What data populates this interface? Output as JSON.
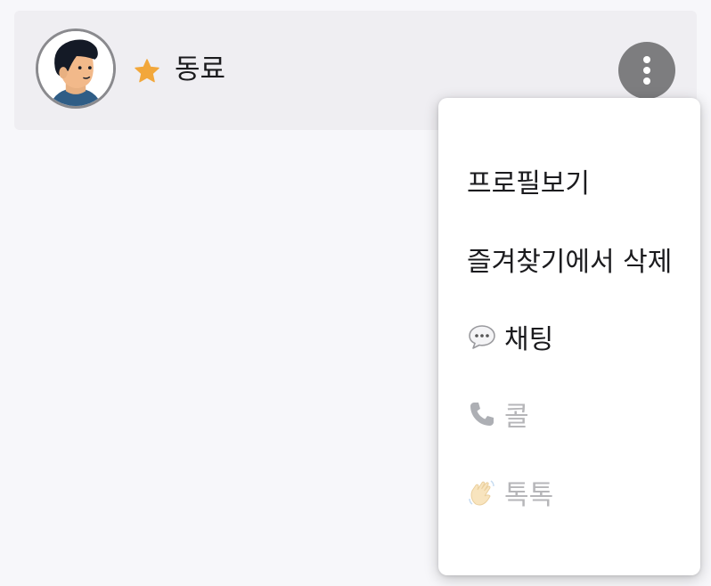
{
  "contact": {
    "name": "동료",
    "favorite_icon": "star-icon",
    "avatar_icon": "person-avatar-icon"
  },
  "more_button": {
    "icon": "more-vertical-icon"
  },
  "menu": {
    "items": [
      {
        "label": "프로필보기",
        "icon": "",
        "enabled": true
      },
      {
        "label": "즐겨찾기에서 삭제",
        "icon": "",
        "enabled": true
      },
      {
        "label": "채팅",
        "icon": "speech-bubble-icon",
        "enabled": true
      },
      {
        "label": "콜",
        "icon": "phone-icon",
        "enabled": false
      },
      {
        "label": "톡톡",
        "icon": "waving-hand-icon",
        "enabled": false
      }
    ]
  },
  "colors": {
    "background": "#f7f7fa",
    "card": "#efeef2",
    "star": "#f2a73b",
    "more_button": "#7d7d7f",
    "disabled_text": "#b6b6b9"
  }
}
